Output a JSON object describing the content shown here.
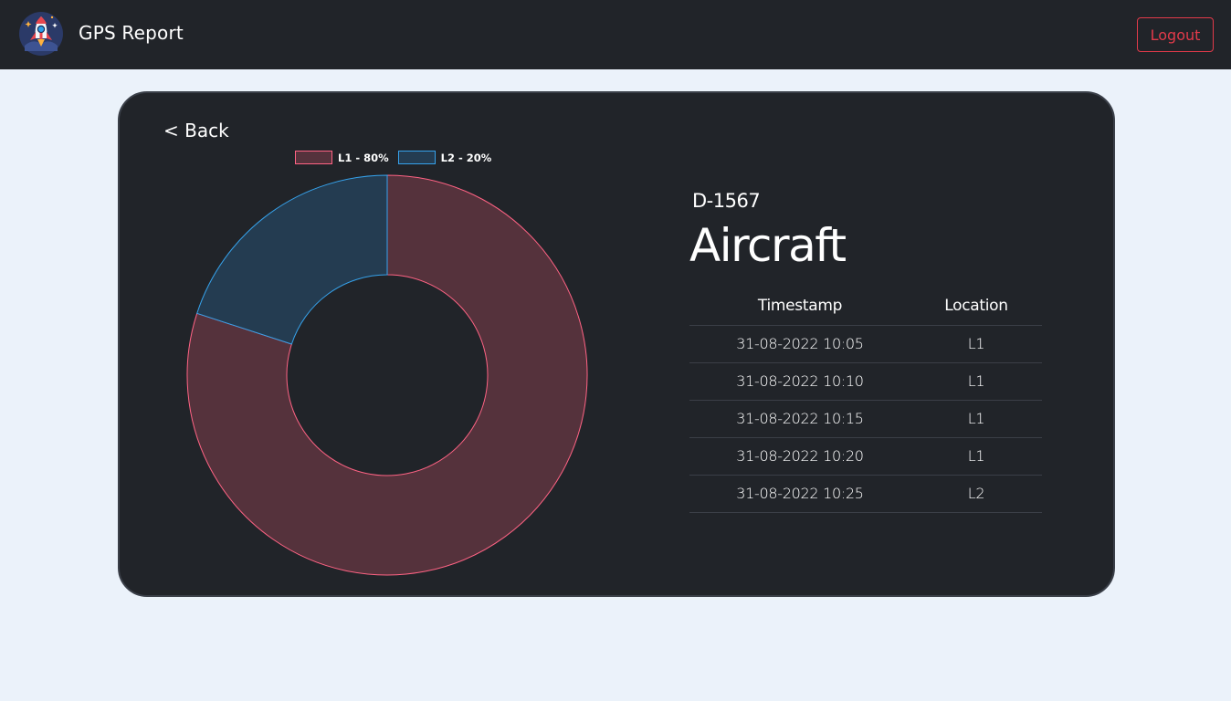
{
  "navbar": {
    "brand_title": "GPS Report",
    "logout_label": "Logout"
  },
  "card": {
    "back_label": "< Back",
    "aircraft_id": "D-1567",
    "aircraft_type": "Aircraft"
  },
  "table": {
    "headers": [
      "Timestamp",
      "Location"
    ],
    "rows": [
      [
        "31-08-2022 10:05",
        "L1"
      ],
      [
        "31-08-2022 10:10",
        "L1"
      ],
      [
        "31-08-2022 10:15",
        "L1"
      ],
      [
        "31-08-2022 10:20",
        "L1"
      ],
      [
        "31-08-2022 10:25",
        "L2"
      ]
    ]
  },
  "chart_data": {
    "type": "pie",
    "variant": "doughnut",
    "categories": [
      "L1 - 80%",
      "L2 - 20%"
    ],
    "values": [
      80,
      20
    ],
    "legend_position": "top",
    "colors": {
      "fill": [
        "#55323c",
        "#243c51"
      ],
      "stroke": [
        "#ff6384",
        "#36a2eb"
      ]
    }
  },
  "colors": {
    "navbar_bg": "#212429",
    "page_bg": "#ebf2fa",
    "card_bg": "#212429",
    "logout_accent": "#e23a4a"
  }
}
